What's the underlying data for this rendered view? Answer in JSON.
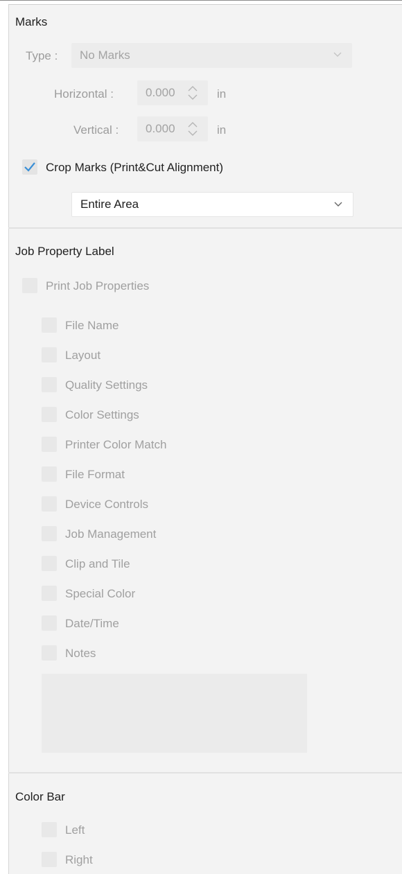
{
  "marks": {
    "heading": "Marks",
    "type_label": "Type :",
    "type_value": "No Marks",
    "horizontal_label": "Horizontal :",
    "horizontal_value": "0.000",
    "horizontal_unit": "in",
    "vertical_label": "Vertical :",
    "vertical_value": "0.000",
    "vertical_unit": "in",
    "crop_marks_label": "Crop Marks (Print&Cut Alignment)",
    "crop_marks_checked": true,
    "area_value": "Entire Area"
  },
  "job_property": {
    "heading": "Job Property Label",
    "print_job_properties": "Print Job Properties",
    "items": [
      "File Name",
      "Layout",
      "Quality Settings",
      "Color Settings",
      "Printer Color Match",
      "File Format",
      "Device Controls",
      "Job Management",
      "Clip and Tile",
      "Special Color",
      "Date/Time",
      "Notes"
    ]
  },
  "color_bar": {
    "heading": "Color Bar",
    "left": "Left",
    "right": "Right"
  },
  "colors": {
    "accent_check": "#3b8fd6",
    "panel_bg": "#f3f3f3"
  }
}
